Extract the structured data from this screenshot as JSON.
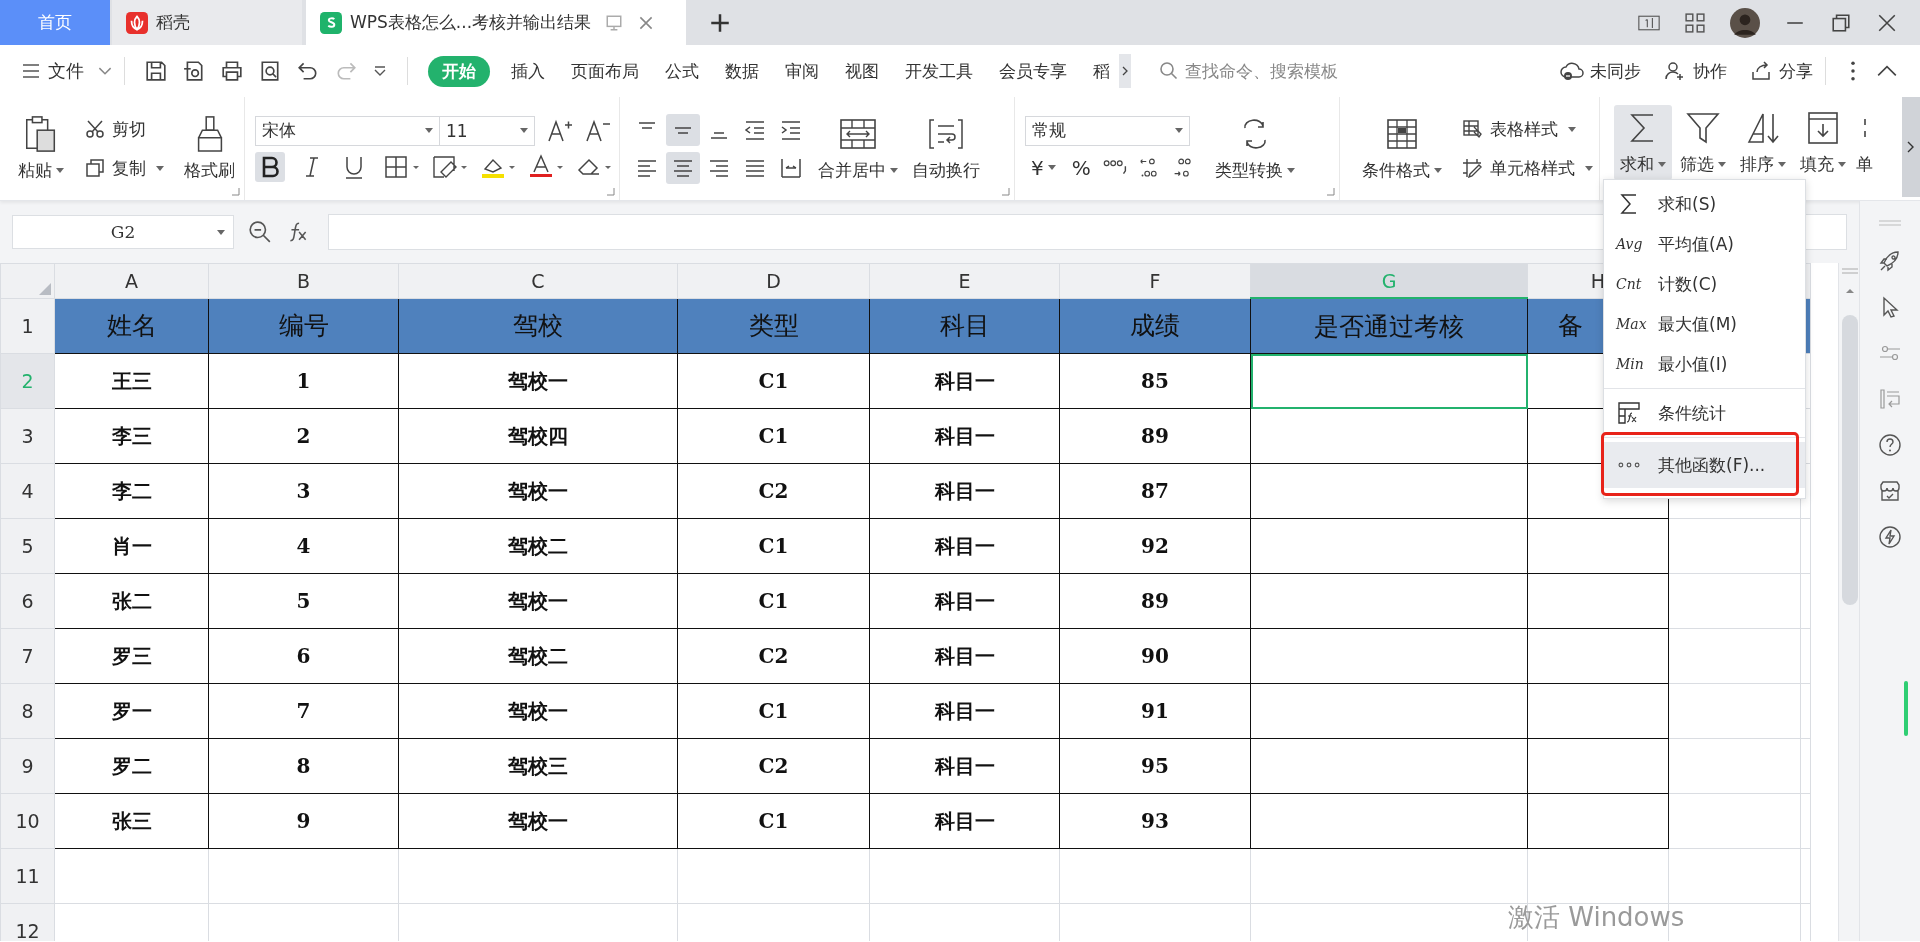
{
  "tabs": [
    {
      "label": "首页",
      "kind": "home",
      "selected": false
    },
    {
      "label": "稻壳",
      "kind": "docer",
      "selected": false
    },
    {
      "label": "WPS表格怎么...考核并输出结果",
      "kind": "sheet",
      "selected": true
    }
  ],
  "menu": {
    "file": "文件",
    "tabs": [
      {
        "label": "开始",
        "selected": true
      },
      {
        "label": "插入",
        "selected": false
      },
      {
        "label": "页面布局",
        "selected": false
      },
      {
        "label": "公式",
        "selected": false
      },
      {
        "label": "数据",
        "selected": false
      },
      {
        "label": "审阅",
        "selected": false
      },
      {
        "label": "视图",
        "selected": false
      },
      {
        "label": "开发工具",
        "selected": false
      },
      {
        "label": "会员专享",
        "selected": false
      },
      {
        "label": "稻",
        "selected": false
      }
    ],
    "search": {
      "placeholder": "查找命令、搜索模板"
    },
    "sync": "未同步",
    "collab": "协作",
    "share": "分享"
  },
  "ribbon": {
    "clipboard": {
      "paste": "粘贴",
      "cut": "剪切",
      "copy": "复制",
      "painter": "格式刷"
    },
    "font": {
      "name": "宋体",
      "size": "11",
      "bold": true
    },
    "alignment": {
      "buttons": [
        {
          "kind": "top",
          "selected": false
        },
        {
          "kind": "middle",
          "selected": true
        },
        {
          "kind": "bottom",
          "selected": false
        },
        {
          "kind": "outdent",
          "selected": false
        },
        {
          "kind": "indent",
          "selected": false
        },
        {
          "kind": "left",
          "selected": false
        },
        {
          "kind": "center",
          "selected": true
        },
        {
          "kind": "right",
          "selected": false
        },
        {
          "kind": "justify",
          "selected": false
        },
        {
          "kind": "distribute",
          "selected": false
        }
      ],
      "merge": "合并居中",
      "wrap": "自动换行"
    },
    "number": {
      "format": "常规",
      "currency": "¥",
      "percent": "%",
      "convert": "类型转换"
    },
    "styles": {
      "conditional": "条件格式",
      "table_style": "表格样式",
      "cell_style": "单元格样式"
    },
    "editing": [
      {
        "label": "求和",
        "kind": "sum",
        "selected": true
      },
      {
        "label": "筛选",
        "kind": "filter",
        "selected": false
      },
      {
        "label": "排序",
        "kind": "sort",
        "selected": false
      },
      {
        "label": "填充",
        "kind": "fill",
        "selected": false
      },
      {
        "label": "单",
        "kind": "cell",
        "selected": false
      }
    ]
  },
  "formula_bar": {
    "name_box": "G2"
  },
  "sheet": {
    "columns": [
      {
        "label": "A",
        "selected": false
      },
      {
        "label": "B",
        "selected": false
      },
      {
        "label": "C",
        "selected": false
      },
      {
        "label": "D",
        "selected": false
      },
      {
        "label": "E",
        "selected": false
      },
      {
        "label": "F",
        "selected": false
      },
      {
        "label": "G",
        "selected": true
      },
      {
        "label": "H",
        "selected": false
      }
    ],
    "rows": [
      {
        "number": "1",
        "selected": false,
        "kind": "header",
        "cells": [
          "姓名",
          "编号",
          "驾校",
          "类型",
          "科目",
          "成绩",
          "是否通过考核",
          "备"
        ]
      },
      {
        "number": "2",
        "selected": true,
        "kind": "data",
        "cells": [
          "王三",
          "1",
          "驾校一",
          "C1",
          "科目一",
          "85"
        ]
      },
      {
        "number": "3",
        "selected": false,
        "kind": "data",
        "cells": [
          "李三",
          "2",
          "驾校四",
          "C1",
          "科目一",
          "89"
        ]
      },
      {
        "number": "4",
        "selected": false,
        "kind": "data",
        "cells": [
          "李二",
          "3",
          "驾校一",
          "C2",
          "科目一",
          "87"
        ]
      },
      {
        "number": "5",
        "selected": false,
        "kind": "data",
        "cells": [
          "肖一",
          "4",
          "驾校二",
          "C1",
          "科目一",
          "92"
        ]
      },
      {
        "number": "6",
        "selected": false,
        "kind": "data",
        "cells": [
          "张二",
          "5",
          "驾校一",
          "C1",
          "科目一",
          "89"
        ]
      },
      {
        "number": "7",
        "selected": false,
        "kind": "data",
        "cells": [
          "罗三",
          "6",
          "驾校二",
          "C2",
          "科目一",
          "90"
        ]
      },
      {
        "number": "8",
        "selected": false,
        "kind": "data",
        "cells": [
          "罗一",
          "7",
          "驾校一",
          "C1",
          "科目一",
          "91"
        ]
      },
      {
        "number": "9",
        "selected": false,
        "kind": "data",
        "cells": [
          "罗二",
          "8",
          "驾校三",
          "C2",
          "科目一",
          "95"
        ]
      },
      {
        "number": "10",
        "selected": false,
        "kind": "data",
        "cells": [
          "张三",
          "9",
          "驾校一",
          "C1",
          "科目一",
          "93"
        ]
      },
      {
        "number": "11",
        "selected": false,
        "kind": "blank"
      },
      {
        "number": "12",
        "selected": false,
        "kind": "blank"
      }
    ]
  },
  "dropdown": {
    "items": [
      {
        "kind": "sum",
        "label": "求和(S)",
        "highlighted": false
      },
      {
        "kind": "text",
        "icon_text": "Avg",
        "label": "平均值(A)",
        "highlighted": false
      },
      {
        "kind": "text",
        "icon_text": "Cnt",
        "label": "计数(C)",
        "highlighted": false
      },
      {
        "kind": "text",
        "icon_text": "Max",
        "label": "最大值(M)",
        "highlighted": false
      },
      {
        "kind": "text",
        "icon_text": "Min",
        "label": "最小值(I)",
        "highlighted": false
      },
      {
        "kind": "stats",
        "label": "条件统计",
        "highlighted": false,
        "divider_before": true
      },
      {
        "kind": "more",
        "label": "其他函数(F)...",
        "highlighted": true,
        "divider_before": true,
        "annotated": true
      }
    ]
  },
  "os_notice": "激活 Windows"
}
